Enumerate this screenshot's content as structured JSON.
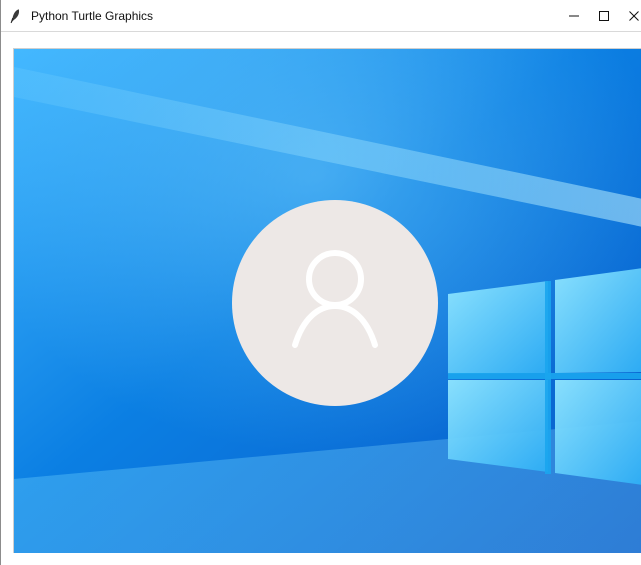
{
  "window": {
    "title": "Python Turtle Graphics",
    "controls": {
      "minimize_icon": "minimize-icon",
      "maximize_icon": "maximize-icon",
      "close_icon": "close-icon"
    }
  },
  "canvas": {
    "wallpaper": {
      "base_color": "#0b7fe3",
      "light_color": "#4fc3ff",
      "pane_color": "#58c7ff"
    },
    "avatar": {
      "circle_color": "#ede8e6",
      "icon_color": "#ffffff",
      "icon_name": "user-icon"
    }
  }
}
